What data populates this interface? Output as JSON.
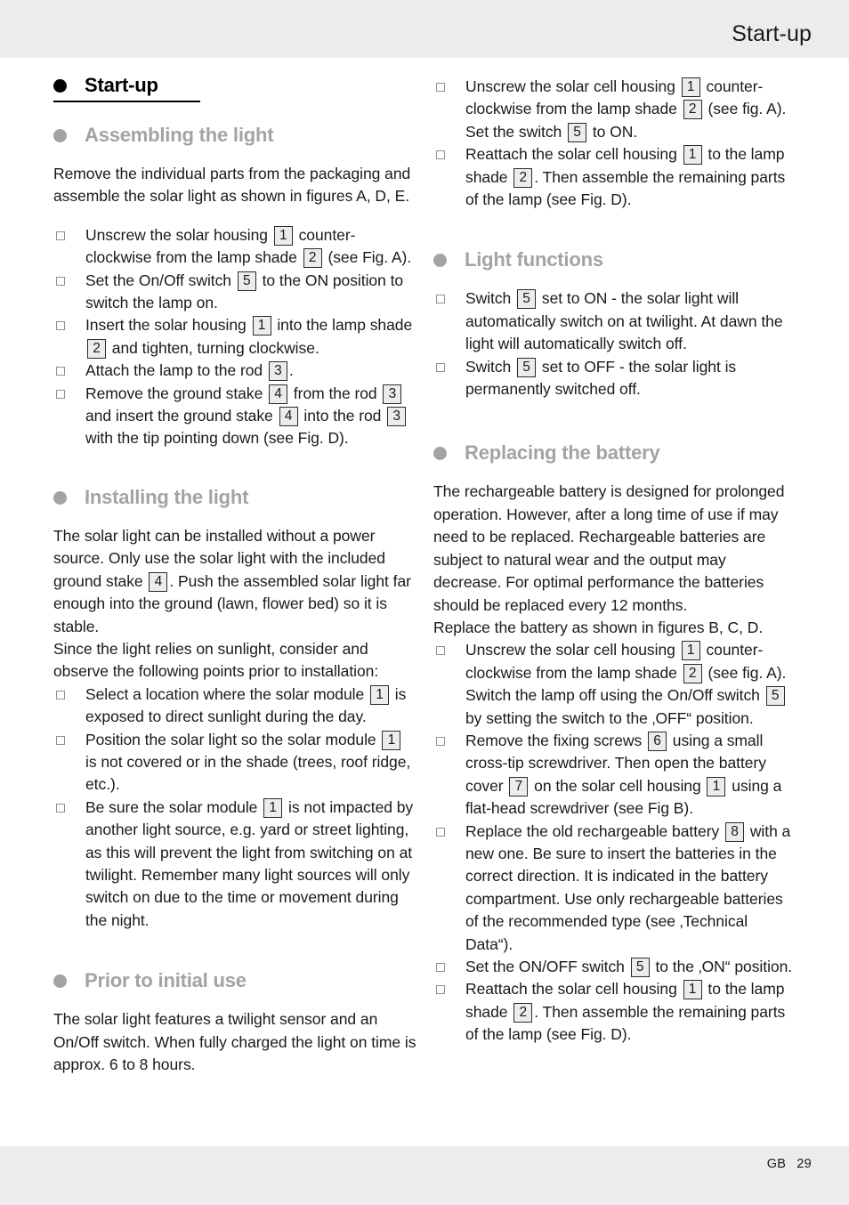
{
  "header": {
    "title": "Start-up"
  },
  "footer": {
    "language": "GB",
    "page_number": "29"
  },
  "left_column": {
    "heading_main": "Start-up",
    "section_assembling": {
      "heading": "Assembling the light",
      "intro": "Remove the individual parts from the packaging and assemble the solar light as shown in figures A, D, E.",
      "steps": [
        "Unscrew the solar housing [1] counter-clockwise from the lamp shade [2] (see Fig. A).",
        "Set the On/Off switch [5] to the ON position to switch the lamp on.",
        "Insert the solar housing [1] into the lamp shade [2] and tighten, turning clockwise.",
        "Attach the lamp to the rod [3].",
        "Remove the ground stake [4] from the rod [3] and insert the ground stake [4] into the rod [3] with the tip pointing down (see Fig. D)."
      ]
    },
    "section_installing": {
      "heading": "Installing the light",
      "para1": "The solar light can be installed without a power source. Only use the solar light with the included ground stake [4]. Push the assembled solar light far enough into the ground (lawn, flower bed) so it is stable.",
      "para2": "Since the light relies on sunlight, consider and observe the following points prior to installation:",
      "steps": [
        "Select a location where the solar module [1] is exposed to direct sunlight during the day.",
        "Position the solar light so the solar module [1] is not covered or in the shade (trees, roof ridge, etc.).",
        "Be sure the solar module [1] is not impacted by another light source, e.g. yard or street lighting, as this will prevent the light from switching on at twilight. Remember many light sources will only switch on due to the time or movement during the night."
      ]
    },
    "section_prior_use": {
      "heading": "Prior to initial use",
      "para": "The solar light features a twilight sensor and an On/Off switch. When fully charged the light on time is approx. 6 to 8 hours."
    }
  },
  "right_column": {
    "top_steps": [
      "Unscrew the solar cell housing [1] counter-clockwise from the lamp shade [2] (see fig. A). Set the switch [5] to ON.",
      "Reattach the solar cell housing [1] to the lamp shade [2]. Then assemble the remaining parts of the lamp (see Fig. D)."
    ],
    "section_light_functions": {
      "heading": "Light functions",
      "steps": [
        "Switch [5] set to ON - the solar light will automatically switch on at twilight. At dawn the light will automatically switch off.",
        "Switch [5] set to OFF - the solar light is permanently switched off."
      ]
    },
    "section_replacing_battery": {
      "heading": "Replacing the battery",
      "para1": "The rechargeable battery is designed for prolonged operation. However, after a long time of use if may need to be replaced. Rechargeable batteries are subject to natural wear and the output may decrease. For optimal performance the batteries should be replaced every 12 months.",
      "para2": "Replace the battery as shown in figures B, C, D.",
      "steps": [
        "Unscrew the solar cell housing [1] counter-clockwise from the lamp shade [2] (see fig. A). Switch the lamp off using the On/Off switch [5] by setting the switch to the ‚OFF“ position.",
        "Remove the fixing screws [6] using a small cross-tip screwdriver. Then open the battery cover [7] on the solar cell housing [1] using a flat-head screwdriver (see Fig B).",
        "Replace the old rechargeable battery [8] with a new one. Be sure to insert the batteries in the correct direction. It is indicated in the battery compartment. Use only rechargeable batteries of the recommended type (see ‚Technical Data“).",
        "Set the ON/OFF switch [5] to the ‚ON“ position.",
        "Reattach the solar cell housing [1] to the lamp shade [2]. Then assemble the remaining parts of the lamp (see Fig. D)."
      ]
    }
  },
  "colors": {
    "band_gray": "#ececec",
    "heading_gray": "#a3a3a3",
    "text_black": "#1a1a1a",
    "refbox_fill": "#ececec",
    "refbox_border": "#2b2b2b"
  }
}
